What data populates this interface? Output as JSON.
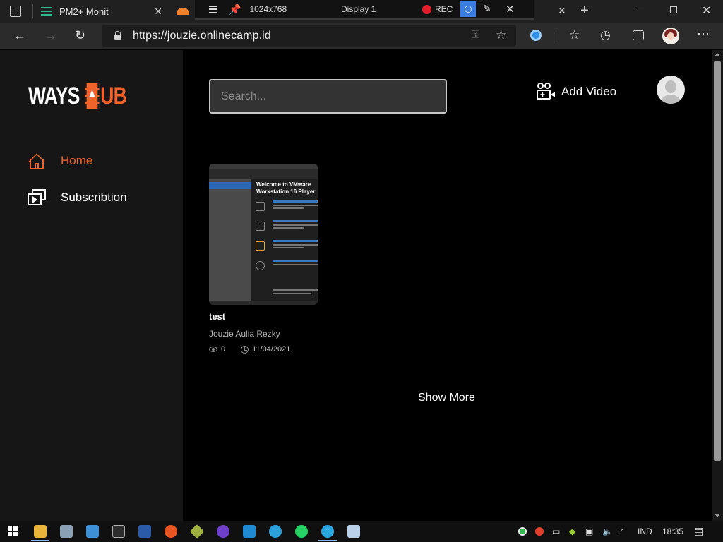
{
  "browser": {
    "tabs": [
      {
        "title": "PM2+ Monit"
      }
    ],
    "overlay": {
      "resolution": "1024x768",
      "display": "Display 1",
      "rec_label": "REC"
    },
    "url": "https://jouzie.onlinecamp.id"
  },
  "app": {
    "logo": {
      "part1": "WAYS",
      "part2": "UB"
    },
    "sidebar": {
      "items": [
        {
          "label": "Home",
          "active": true
        },
        {
          "label": "Subscribtion",
          "active": false
        }
      ]
    },
    "header": {
      "search_placeholder": "Search...",
      "add_video_label": "Add Video"
    },
    "videos": [
      {
        "title": "test",
        "channel": "Jouzie Aulia Rezky",
        "views": "0",
        "date": "11/04/2021",
        "thumbnail": {
          "heading": "Welcome to VMware Workstation 16 Player"
        }
      }
    ],
    "show_more_label": "Show More"
  },
  "colors": {
    "accent": "#f0632b",
    "sidebar_bg": "#161616",
    "page_bg": "#000000"
  },
  "taskbar": {
    "language": "IND",
    "time": "18:35"
  }
}
